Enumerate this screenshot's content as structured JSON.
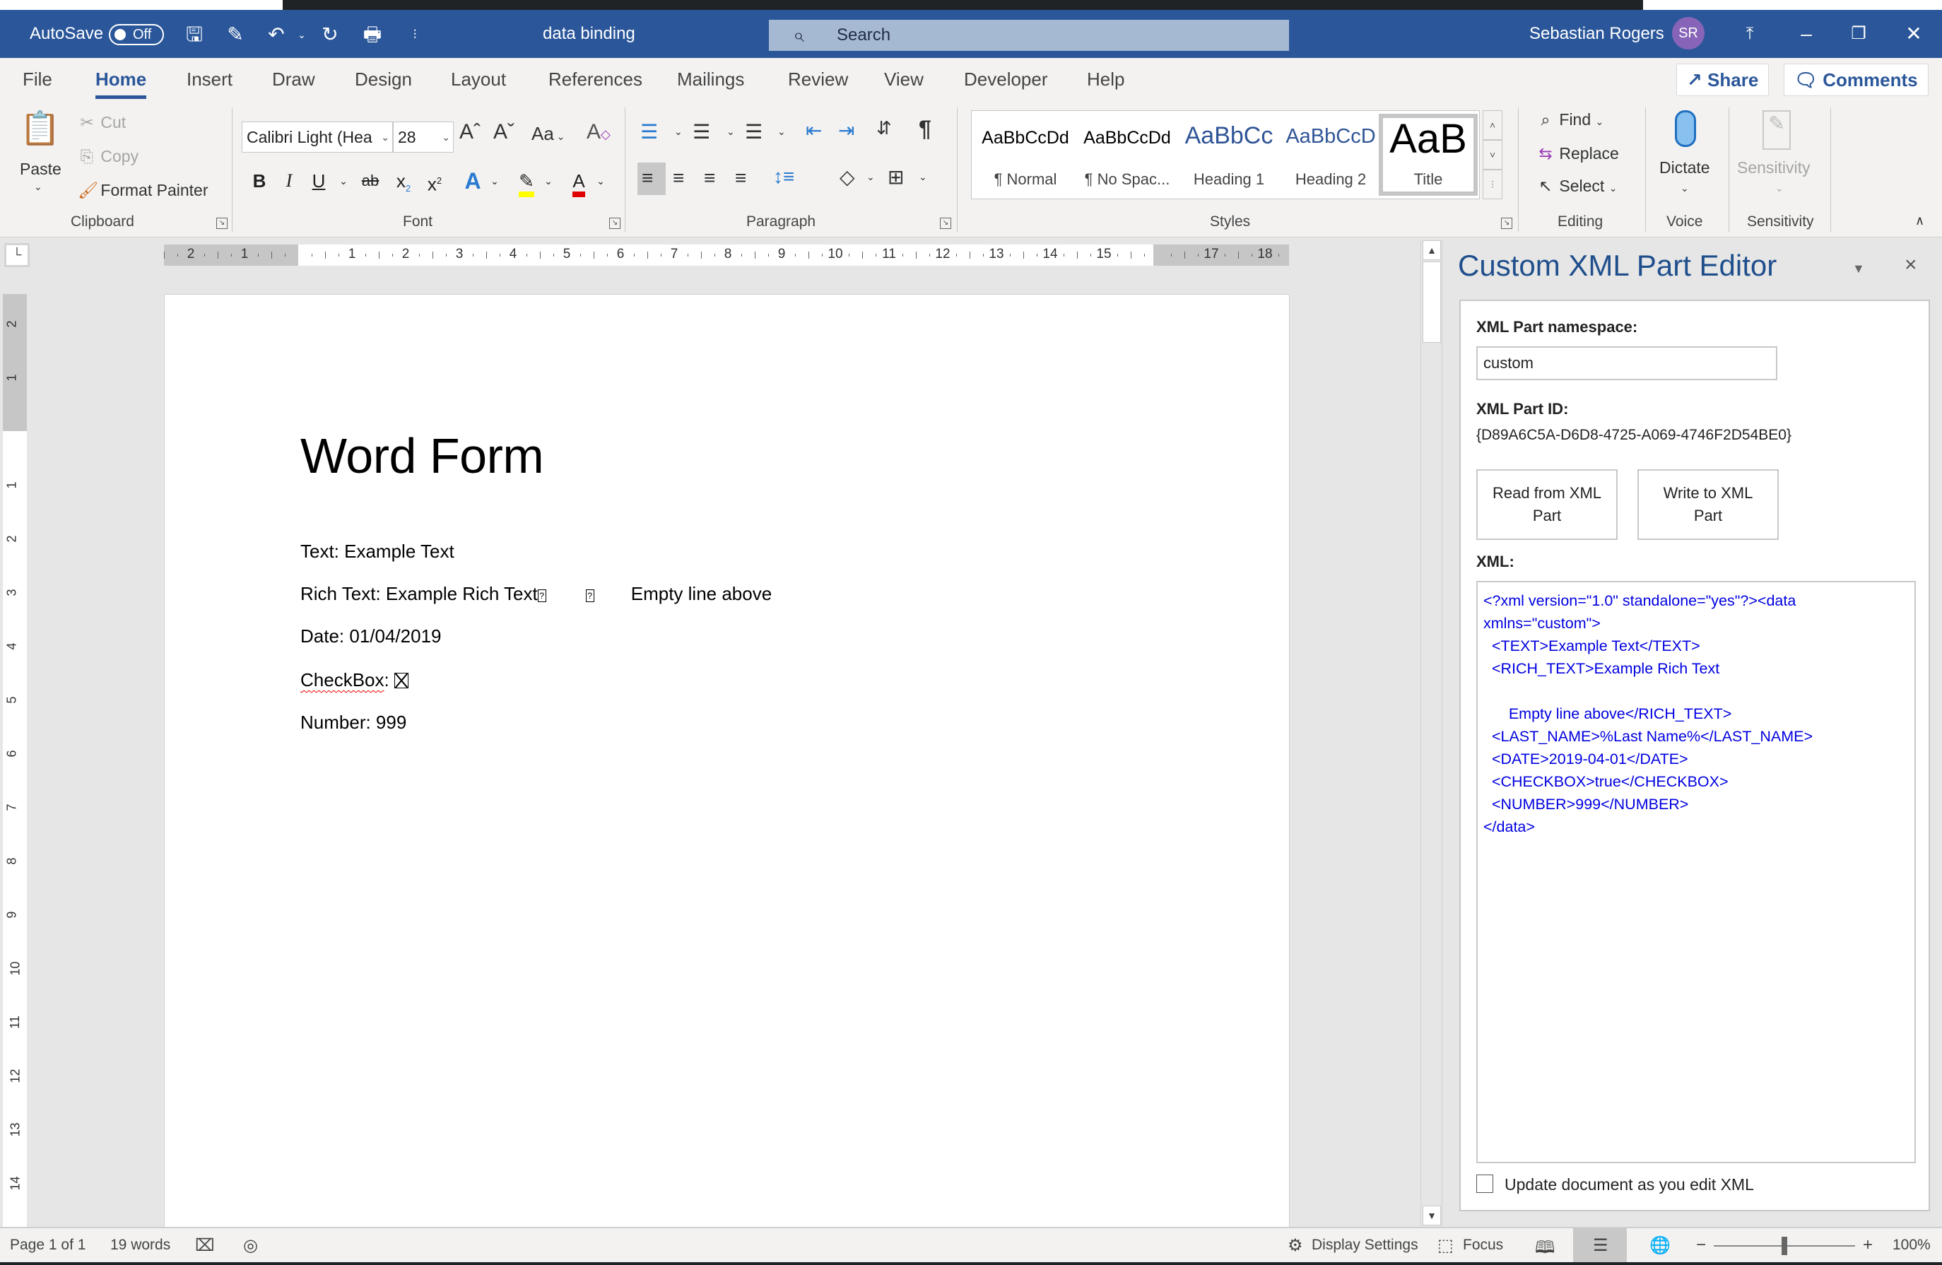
{
  "titlebar": {
    "autosave_label": "AutoSave",
    "autosave_state": "Off",
    "document_title": "data binding",
    "search_placeholder": "Search",
    "user_name": "Sebastian Rogers",
    "user_initials": "SR",
    "accent_color": "#2b579a"
  },
  "tabs": [
    {
      "label": "File"
    },
    {
      "label": "Home",
      "active": true
    },
    {
      "label": "Insert"
    },
    {
      "label": "Draw"
    },
    {
      "label": "Design"
    },
    {
      "label": "Layout"
    },
    {
      "label": "References"
    },
    {
      "label": "Mailings"
    },
    {
      "label": "Review"
    },
    {
      "label": "View"
    },
    {
      "label": "Developer"
    },
    {
      "label": "Help"
    }
  ],
  "header_buttons": {
    "share": "Share",
    "comments": "Comments"
  },
  "ribbon": {
    "clipboard": {
      "label": "Clipboard",
      "paste": "Paste",
      "cut": "Cut",
      "copy": "Copy",
      "format_painter": "Format Painter"
    },
    "font": {
      "label": "Font",
      "font_name": "Calibri Light (Hea",
      "font_size": "28",
      "change_case": "Aa"
    },
    "paragraph": {
      "label": "Paragraph"
    },
    "styles": {
      "label": "Styles",
      "items": [
        {
          "preview": "AaBbCcDd",
          "name": "¶ Normal"
        },
        {
          "preview": "AaBbCcDd",
          "name": "¶ No Spac..."
        },
        {
          "preview": "AaBbCc",
          "name": "Heading 1"
        },
        {
          "preview": "AaBbCcD",
          "name": "Heading 2"
        },
        {
          "preview": "AaB",
          "name": "Title",
          "selected": true
        }
      ]
    },
    "editing": {
      "label": "Editing",
      "find": "Find",
      "replace": "Replace",
      "select": "Select"
    },
    "voice": {
      "label": "Voice",
      "dictate": "Dictate"
    },
    "sensitivity": {
      "label": "Sensitivity",
      "button": "Sensitivity"
    }
  },
  "ruler": {
    "left_numbers": [
      "2",
      "1"
    ],
    "right_numbers": [
      "1",
      "2",
      "3",
      "4",
      "5",
      "6",
      "7",
      "8",
      "9",
      "10",
      "11",
      "12",
      "13",
      "14",
      "15",
      "",
      "17",
      "18"
    ],
    "vertical_numbers": [
      "2",
      "1",
      "1",
      "2",
      "3",
      "4",
      "5",
      "6",
      "7",
      "8",
      "9",
      "10",
      "11",
      "12",
      "13",
      "14"
    ]
  },
  "document": {
    "title": "Word Form",
    "text_line": "Text: Example Text",
    "rich_text_prefix": "Rich Text: Example Rich Text",
    "rich_text_suffix": "Empty line above",
    "date_line": "Date: 01/04/2019",
    "checkbox_label": "CheckBox",
    "checkbox_sep": ":",
    "checkbox_checked": true,
    "number_line": "Number: 999"
  },
  "task_pane": {
    "title": "Custom XML Part Editor",
    "namespace_label": "XML Part namespace:",
    "namespace_value": "custom",
    "part_id_label": "XML Part ID:",
    "part_id_value": "{D89A6C5A-D6D8-4725-A069-4746F2D54BE0}",
    "read_button": "Read from XML Part",
    "write_button": "Write to XML Part",
    "xml_label": "XML:",
    "xml_content": "<?xml version=\"1.0\" standalone=\"yes\"?><data\nxmlns=\"custom\">\n  <TEXT>Example Text</TEXT>\n  <RICH_TEXT>Example Rich Text\n\n      Empty line above</RICH_TEXT>\n  <LAST_NAME>%Last Name%</LAST_NAME>\n  <DATE>2019-04-01</DATE>\n  <CHECKBOX>true</CHECKBOX>\n  <NUMBER>999</NUMBER>\n</data>",
    "update_checkbox_label": "Update document as you edit XML",
    "update_checked": false
  },
  "status_bar": {
    "page": "Page 1 of 1",
    "words": "19 words",
    "display_settings": "Display Settings",
    "focus": "Focus",
    "zoom_level": "100%",
    "zoom_percent": 100
  }
}
